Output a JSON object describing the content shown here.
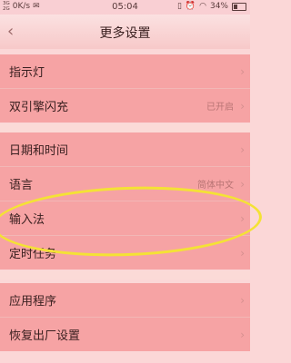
{
  "status": {
    "signal_top": "3G",
    "signal_bottom": "2G",
    "speed": "0K/s",
    "time": "05:04",
    "battery": "34%",
    "battery_level": 0.34
  },
  "header": {
    "back_icon": "chevron-left-icon",
    "title": "更多设置"
  },
  "groups": [
    {
      "items": [
        {
          "label": "指示灯",
          "value": ""
        },
        {
          "label": "双引擎闪充",
          "value": "已开启"
        }
      ]
    },
    {
      "items": [
        {
          "label": "日期和时间",
          "value": ""
        },
        {
          "label": "语言",
          "value": "简体中文"
        },
        {
          "label": "输入法",
          "value": ""
        },
        {
          "label": "定时任务",
          "value": ""
        }
      ]
    },
    {
      "items": [
        {
          "label": "应用程序",
          "value": ""
        },
        {
          "label": "恢复出厂设置",
          "value": ""
        }
      ]
    }
  ]
}
